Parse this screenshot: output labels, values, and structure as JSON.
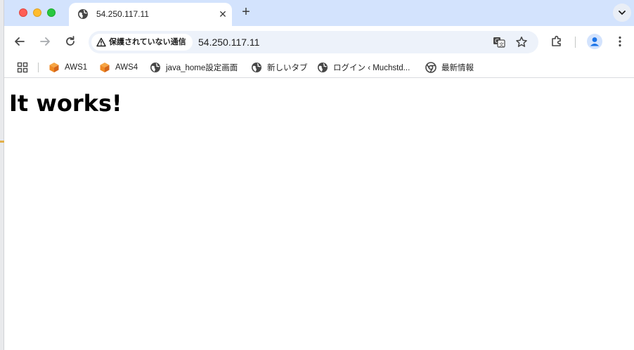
{
  "tab": {
    "title": "54.250.117.11",
    "close_glyph": "✕",
    "new_tab_glyph": "+"
  },
  "toolbar": {
    "security_label": "保護されていない通信",
    "url": "54.250.117.11",
    "icons": [
      "back-icon",
      "forward-icon",
      "reload-icon",
      "translate-icon",
      "star-icon",
      "extensions-icon",
      "profile-icon",
      "menu-icon"
    ]
  },
  "bookmarks": [
    {
      "label": "AWS1",
      "icon": "aws-cube-icon"
    },
    {
      "label": "AWS4",
      "icon": "aws-cube-icon"
    },
    {
      "label": "java_home設定画面",
      "icon": "globe-icon"
    },
    {
      "label": "新しいタブ",
      "icon": "globe-icon"
    },
    {
      "label": "ログイン ‹ Muchstd...",
      "icon": "globe-icon"
    },
    {
      "label": "最新情報",
      "icon": "chrome-icon"
    }
  ],
  "page": {
    "heading": "It works!"
  },
  "colors": {
    "tabstrip": "#d3e3fd",
    "omnibox": "#edf2fa",
    "aws_orange": "#f08a24",
    "profile_blue": "#1a73e8"
  }
}
